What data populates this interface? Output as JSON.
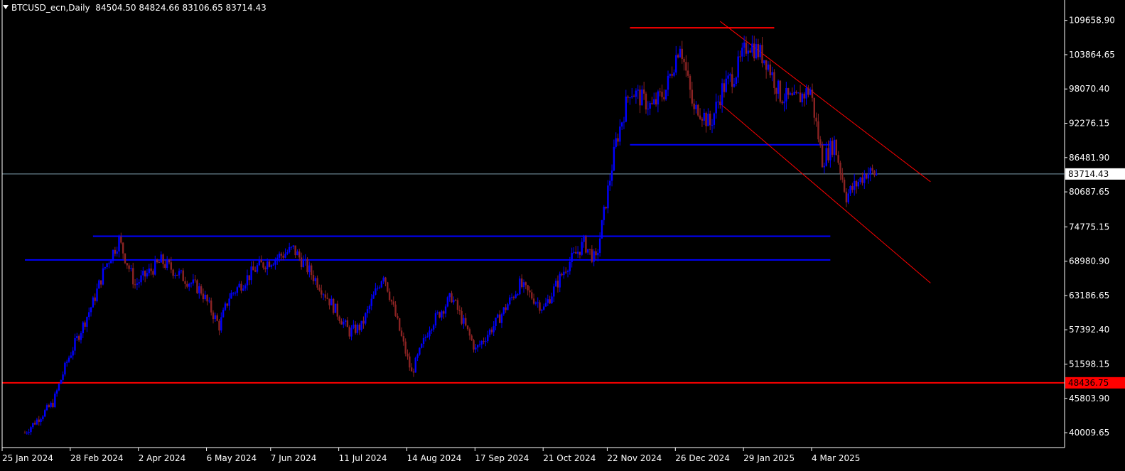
{
  "header": {
    "symbol_timeframe": "BTCUSD_ecn,Daily",
    "ohlc": "84504.50 84824.66 83106.65 83714.43"
  },
  "colors": {
    "background": "#000000",
    "bull_candle": "#0000ff",
    "bear_candle": "#8b2323",
    "axis": "#ffffff",
    "bid_line": "#7f9fb0",
    "support_line": "#ff0000",
    "resistance_blue": "#0000ff",
    "channel": "#ff0000"
  },
  "chart_data": {
    "type": "candlestick",
    "ylim": [
      37500,
      112500
    ],
    "y_ticks": [
      "109658.90",
      "103864.65",
      "98070.40",
      "92276.15",
      "86481.90",
      "80687.65",
      "74775.15",
      "68980.90",
      "63186.65",
      "57392.40",
      "51598.15",
      "45803.90",
      "40009.65"
    ],
    "x_ticks": [
      "25 Jan 2024",
      "28 Feb 2024",
      "2 Apr 2024",
      "6 May 2024",
      "7 Jun 2024",
      "11 Jul 2024",
      "14 Aug 2024",
      "17 Sep 2024",
      "21 Oct 2024",
      "22 Nov 2024",
      "26 Dec 2024",
      "29 Jan 2025",
      "4 Mar 2025"
    ],
    "current_price": {
      "value": 83714.43,
      "label": "83714.43"
    },
    "horizontal_level": {
      "value": 48436.75,
      "label": "48436.75"
    },
    "price_path": [
      [
        "25 Jan 2024",
        40000
      ],
      [
        "8 Feb 2024",
        45000
      ],
      [
        "15 Feb 2024",
        52000
      ],
      [
        "28 Feb 2024",
        62000
      ],
      [
        "5 Mar 2024",
        68000
      ],
      [
        "12 Mar 2024",
        72500
      ],
      [
        "20 Mar 2024",
        65000
      ],
      [
        "2 Apr 2024",
        69000
      ],
      [
        "10 Apr 2024",
        67000
      ],
      [
        "22 Apr 2024",
        64000
      ],
      [
        "1 May 2024",
        58000
      ],
      [
        "6 May 2024",
        63000
      ],
      [
        "20 May 2024",
        68000
      ],
      [
        "7 Jun 2024",
        71000
      ],
      [
        "20 Jun 2024",
        65000
      ],
      [
        "5 Jul 2024",
        57000
      ],
      [
        "11 Jul 2024",
        58000
      ],
      [
        "22 Jul 2024",
        67000
      ],
      [
        "5 Aug 2024",
        50000
      ],
      [
        "14 Aug 2024",
        58000
      ],
      [
        "25 Aug 2024",
        63000
      ],
      [
        "6 Sep 2024",
        54000
      ],
      [
        "17 Sep 2024",
        59000
      ],
      [
        "28 Sep 2024",
        65000
      ],
      [
        "10 Oct 2024",
        61000
      ],
      [
        "21 Oct 2024",
        68000
      ],
      [
        "30 Oct 2024",
        72000
      ],
      [
        "5 Nov 2024",
        69000
      ],
      [
        "11 Nov 2024",
        81000
      ],
      [
        "15 Nov 2024",
        89000
      ],
      [
        "22 Nov 2024",
        98000
      ],
      [
        "3 Dec 2024",
        95000
      ],
      [
        "10 Dec 2024",
        98000
      ],
      [
        "17 Dec 2024",
        106000
      ],
      [
        "24 Dec 2024",
        94000
      ],
      [
        "26 Dec 2024",
        95000
      ],
      [
        "1 Jan 2025",
        92000
      ],
      [
        "7 Jan 2025",
        98000
      ],
      [
        "14 Jan 2025",
        101000
      ],
      [
        "20 Jan 2025",
        106000
      ],
      [
        "29 Jan 2025",
        103000
      ],
      [
        "5 Feb 2025",
        97000
      ],
      [
        "12 Feb 2025",
        96000
      ],
      [
        "20 Feb 2025",
        98000
      ],
      [
        "26 Feb 2025",
        86000
      ],
      [
        "4 Mar 2025",
        89000
      ],
      [
        "10 Mar 2025",
        80000
      ],
      [
        "20 Mar 2025",
        84000
      ],
      [
        "25 Mar 2025",
        83714
      ]
    ],
    "blue_levels": [
      {
        "value": 88650,
        "from": "22 Nov 2024",
        "to": "2 Mar 2025"
      },
      {
        "value": 73200,
        "from": "28 Feb 2024",
        "to": "2 Mar 2025"
      },
      {
        "value": 69200,
        "from": "25 Jan 2024",
        "to": "2 Mar 2025"
      }
    ],
    "red_levels": [
      {
        "value": 108400,
        "from": "22 Nov 2024",
        "to": "2 Feb 2025"
      }
    ],
    "channel": {
      "upper": [
        [
          "6 Jan 2025",
          109500
        ],
        [
          "21 Apr 2025",
          82400
        ]
      ],
      "lower": [
        [
          "6 Jan 2025",
          95600
        ],
        [
          "21 Apr 2025",
          65300
        ]
      ]
    }
  }
}
